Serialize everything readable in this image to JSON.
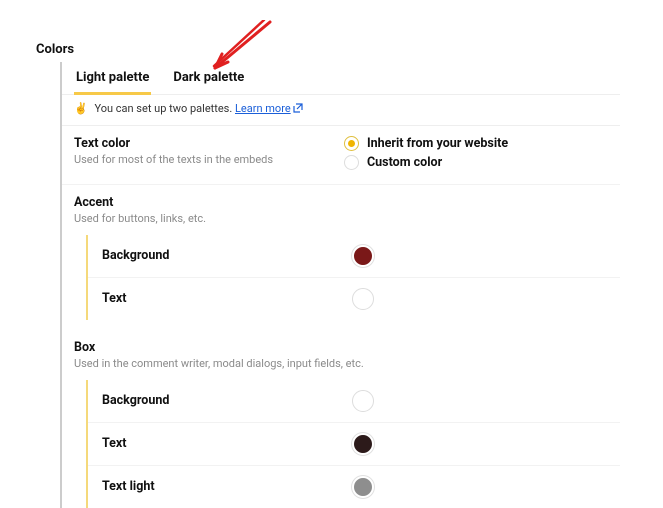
{
  "title": "Colors",
  "tabs": {
    "light": "Light palette",
    "dark": "Dark palette"
  },
  "tip": {
    "emoji": "✌️",
    "text": "You can set up two palettes.",
    "link_text": "Learn more"
  },
  "text_color": {
    "label": "Text color",
    "sub": "Used for most of the texts in the embeds",
    "opt_inherit": "Inherit from your website",
    "opt_custom": "Custom color"
  },
  "accent": {
    "title": "Accent",
    "sub": "Used for buttons, links, etc.",
    "background_label": "Background",
    "text_label": "Text",
    "background_color": "#7a1818",
    "text_color": "#ffffff"
  },
  "box": {
    "title": "Box",
    "sub": "Used in the comment writer, modal dialogs, input fields, etc.",
    "background_label": "Background",
    "text_label": "Text",
    "text_light_label": "Text light",
    "background_color": "#ffffff",
    "text_color": "#2c1a1a",
    "text_light_color": "#8e8e8e"
  }
}
